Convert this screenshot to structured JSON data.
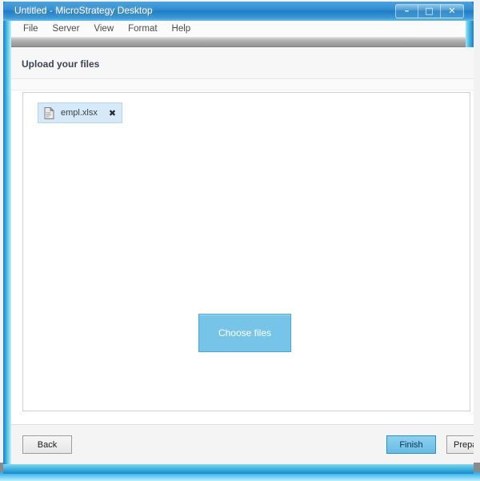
{
  "window": {
    "title": "Untitled - MicroStrategy Desktop",
    "controls": {
      "minimize": "–",
      "maximize": "□",
      "close": "✕"
    },
    "control_names": {
      "minimize": "minimize-icon",
      "maximize": "maximize-icon",
      "close": "close-icon"
    }
  },
  "menubar": {
    "items": [
      {
        "label": "File"
      },
      {
        "label": "Server"
      },
      {
        "label": "View"
      },
      {
        "label": "Format"
      },
      {
        "label": "Help"
      }
    ]
  },
  "wizard": {
    "header_title": "Upload your files",
    "drop_area": {
      "file_chips": [
        {
          "name": "empl.xlsx",
          "icon": "file-icon",
          "remove_label": "✖"
        }
      ],
      "choose_files_label": "Choose files"
    }
  },
  "footer": {
    "back_label": "Back",
    "finish_label": "Finish",
    "prepare_label": "Prepa"
  },
  "colors": {
    "titlebar_blue": "#2f8ed0",
    "accent_blue": "#76c5e8",
    "chip_bg": "#d6e9f8",
    "chip_border": "#b4d4ee",
    "finish_blue": "#64bde6",
    "toolbar_gray": "#a2a2a2",
    "panel_border": "#cfcfcf"
  }
}
